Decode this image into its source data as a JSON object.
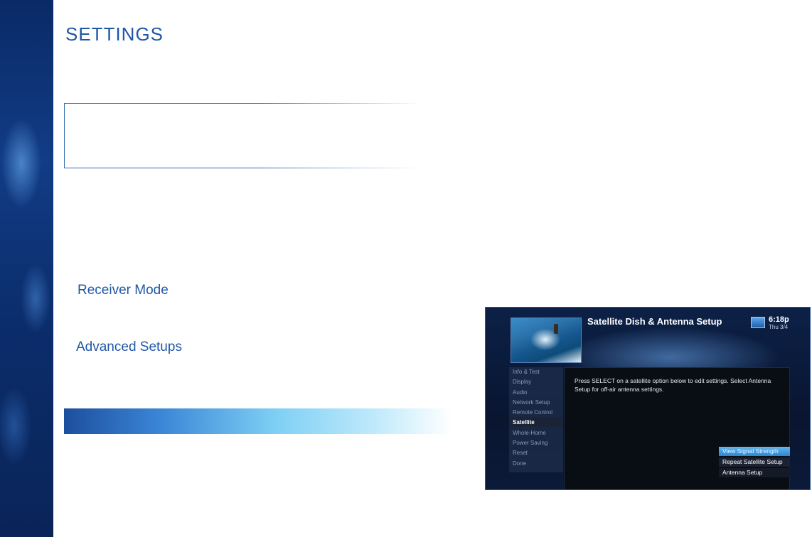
{
  "page": {
    "title": "SETTINGS",
    "links": {
      "receiver_mode": "Receiver Mode",
      "advanced_setups": "Advanced Setups"
    }
  },
  "tv": {
    "title": "Satellite Dish & Antenna Setup",
    "time": "6:18p",
    "date": "Thu 3/4",
    "menu": [
      "Info & Test",
      "Display",
      "Audio",
      "Network Setup",
      "Remote Control",
      "Satellite",
      "Whole-Home",
      "Power Saving",
      "Reset",
      "Done"
    ],
    "active_menu": "Satellite",
    "description": "Press SELECT on a satellite option below to edit settings. Select Antenna Setup for off-air antenna settings.",
    "buttons": [
      "View Signal Strength",
      "Repeat Satellite Setup",
      "Antenna Setup"
    ]
  },
  "colors": {
    "brand_blue": "#1f57a6",
    "highlight": "#2a86d1"
  }
}
